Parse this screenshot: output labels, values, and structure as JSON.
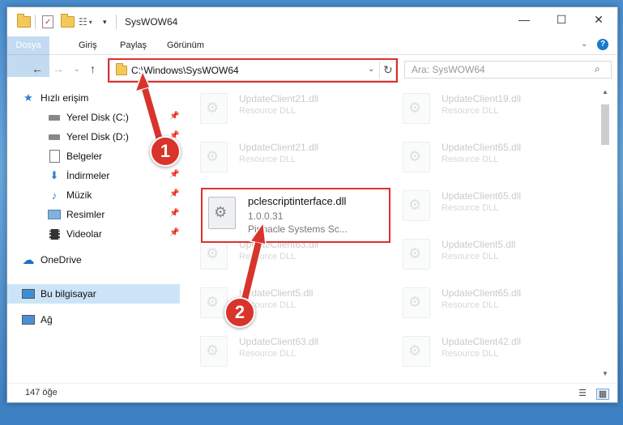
{
  "window": {
    "title": "SysWOW64",
    "controls": {
      "minimize": "—",
      "maximize": "☐",
      "close": "✕"
    }
  },
  "ribbon": {
    "tabs": [
      {
        "label": "Dosya"
      },
      {
        "label": "Giriş"
      },
      {
        "label": "Paylaş"
      },
      {
        "label": "Görünüm"
      }
    ],
    "help_label": "?"
  },
  "navigation": {
    "address": "C:\\Windows\\SysWOW64",
    "search_placeholder": "Ara: SysWOW64"
  },
  "sidebar": {
    "items": [
      {
        "label": "Hızlı erişim",
        "icon": "star-icon"
      },
      {
        "label": "Yerel Disk (C:)",
        "icon": "drive-icon"
      },
      {
        "label": "Yerel Disk (D:)",
        "icon": "drive-icon"
      },
      {
        "label": "Belgeler",
        "icon": "documents-icon"
      },
      {
        "label": "İndirmeler",
        "icon": "download-icon"
      },
      {
        "label": "Müzik",
        "icon": "music-icon"
      },
      {
        "label": "Resimler",
        "icon": "pictures-icon"
      },
      {
        "label": "Videolar",
        "icon": "video-icon"
      },
      {
        "label": "OneDrive",
        "icon": "cloud-icon"
      },
      {
        "label": "Bu bilgisayar",
        "icon": "computer-icon",
        "selected": true
      },
      {
        "label": "Ağ",
        "icon": "network-icon"
      }
    ]
  },
  "files": [
    {
      "name": "UpdateClient21.dll",
      "desc": "Resource DLL"
    },
    {
      "name": "UpdateClient19.dll",
      "desc": "Resource DLL"
    },
    {
      "name": "UpdateClient21.dll",
      "desc": "Resource DLL"
    },
    {
      "name": "UpdateClient65.dll",
      "desc": "Resource DLL"
    },
    {
      "name": "UpdateClient65.dll",
      "desc": "Resource DLL"
    },
    {
      "name": "UpdateClient63.dll",
      "desc": "Resource DLL"
    },
    {
      "name": "UpdateClient5.dll",
      "desc": "Resource DLL"
    },
    {
      "name": "UpdateClient5.dll",
      "desc": "Resource DLL"
    },
    {
      "name": "UpdateClient65.dll",
      "desc": "Resource DLL"
    },
    {
      "name": "UpdateClient63.dll",
      "desc": "Resource DLL"
    },
    {
      "name": "UpdateClient42.dll",
      "desc": "Resource DLL"
    }
  ],
  "selected_file": {
    "name": "pclescriptinterface.dll",
    "version": "1.0.0.31",
    "company": "Pinnacle Systems Sc..."
  },
  "status": {
    "count": "147 öğe"
  },
  "callouts": [
    "1",
    "2"
  ],
  "colors": {
    "accent": "#1979ca",
    "highlight_red": "#e0302c",
    "callout_red": "#d9342b"
  }
}
